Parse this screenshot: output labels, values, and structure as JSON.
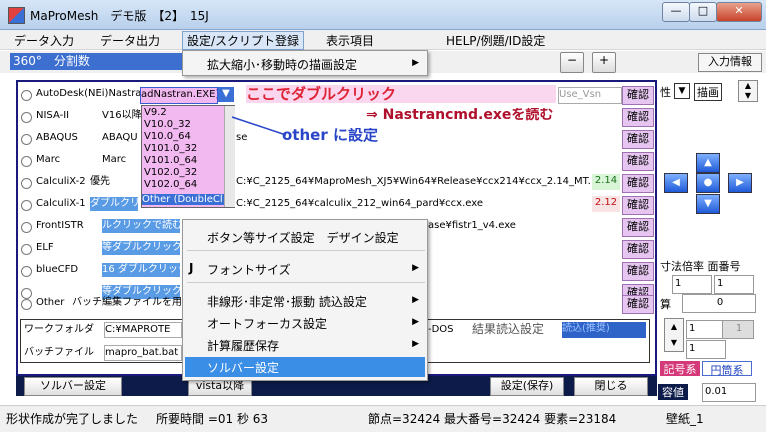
{
  "window": {
    "title": "MaProMesh　デモ版　【2】　15J",
    "min": "—",
    "max": "□",
    "close": "✕"
  },
  "menu": [
    "データ入力",
    "データ出力",
    "設定/スクリプト登録",
    "表示項目",
    "HELP/例題/ID設定"
  ],
  "toolbar": {
    "steps": "360°　分割数",
    "zoom_out": "−",
    "zoom_in": "+",
    "input_info": "入力情報"
  },
  "annotations": {
    "double_click": "ここでダブルクリック",
    "read_exe": "⇒ Nastrancmd.exeを読む",
    "other_set": "other に設定"
  },
  "solvers": [
    {
      "name": "AutoDesk(NEi)Nastran",
      "combo": "adNastran.EXE)",
      "c2": "",
      "c3": "",
      "badge": "",
      "use": "Use_Vsn"
    },
    {
      "name": "NISA-II",
      "combo": "V16以降",
      "c2": "",
      "c3": "",
      "badge": "",
      "use": ""
    },
    {
      "name": "ABAQUS",
      "combo": "ABAQU",
      "c2": "se",
      "c3": "",
      "badge": "",
      "use": ""
    },
    {
      "name": "Marc",
      "combo": "Marc",
      "c2": "",
      "c3": "",
      "badge": "",
      "use": ""
    },
    {
      "name": "CalculiX-2",
      "combo": "優先",
      "c2": "C:¥C_2125_64¥MaproMesh_XJ5¥Win64¥Release¥ccx214¥ccx_2.14_MT.exe",
      "c3": "",
      "badge": "2.14",
      "use": ""
    },
    {
      "name": "CalculiX-1",
      "combo": "ダブルクリッ",
      "c2": "C:¥C_2125_64¥calculix_212_win64_pard¥ccx.exe",
      "c3": "",
      "badge": "2.12",
      "use": ""
    },
    {
      "name": "FrontISTR",
      "combo": "ルクリックで読む",
      "c2": "ase¥fistr1_v4.exe",
      "c3": "",
      "badge": "",
      "use": ""
    },
    {
      "name": "ELF",
      "combo": "等ダブルクリック",
      "c2": "",
      "c3": "",
      "badge": "",
      "use": ""
    },
    {
      "name": "blueCFD",
      "combo": "16 ダブルクリック",
      "c2": "",
      "c3": "",
      "badge": "",
      "use": ""
    },
    {
      "name": "",
      "combo": "等ダブルクリック",
      "c2": "",
      "c3": "",
      "badge": "",
      "use": ""
    },
    {
      "name": "Other",
      "combo": "バッチ編集ファイルを用い",
      "c2": "",
      "c3": "",
      "badge": "",
      "use": ""
    }
  ],
  "confirm_label": "確認",
  "version_list": [
    "V9.2",
    "V10.0_32",
    "V10.0_64",
    "V101.0_32",
    "V101.0_64",
    "V102.0_32",
    "V102.0_64",
    "Other (DoubleCl"
  ],
  "context_top": {
    "label": "拡大縮小･移動時の描画設定",
    "arrow": "▶"
  },
  "context_menu": [
    {
      "label": "ボタン等サイズ設定　デザイン設定",
      "arrow": "",
      "prefix": ""
    },
    {
      "label": "フォントサイズ",
      "arrow": "▶",
      "prefix": "J"
    },
    {
      "label": "非線形･非定常･振動 読込設定",
      "arrow": "▶",
      "prefix": ""
    },
    {
      "label": "オートフォーカス設定",
      "arrow": "▶",
      "prefix": ""
    },
    {
      "label": "計算履歴保存",
      "arrow": "▶",
      "prefix": ""
    },
    {
      "label": "ソルバー設定",
      "arrow": "",
      "prefix": ""
    }
  ],
  "workfolder": {
    "label": "ワークフォルダ",
    "value": "C:¥MAPROTE",
    "dos": "-DOS",
    "result_label": "結果読込設定",
    "result_value": "読込(推奨)"
  },
  "batch": {
    "label": "バッチファイル",
    "value": "mapro_bat.bat"
  },
  "bottom_buttons": {
    "solver": "ソルバー設定",
    "vista": "vista以降",
    "save": "設定(保存)",
    "close": "閉じる"
  },
  "right_panel": {
    "attr": "性",
    "draw": "描画",
    "scale_label": "寸法倍率 面番号",
    "s1": "1",
    "s2": "1",
    "sum_label": "算",
    "sum_val": "0",
    "spin1": "1",
    "spin2": "1",
    "spin3": "1",
    "kigo": "記号系",
    "circle": "円筒系",
    "tol_label": "容値",
    "tol_val": "0.01"
  },
  "status": {
    "msg": "形状作成が完了しました",
    "time": "所要時間 =01 秒 63",
    "nodes": "節点=32424 最大番号=32424 要素=23184",
    "wall": "壁紙_1"
  }
}
